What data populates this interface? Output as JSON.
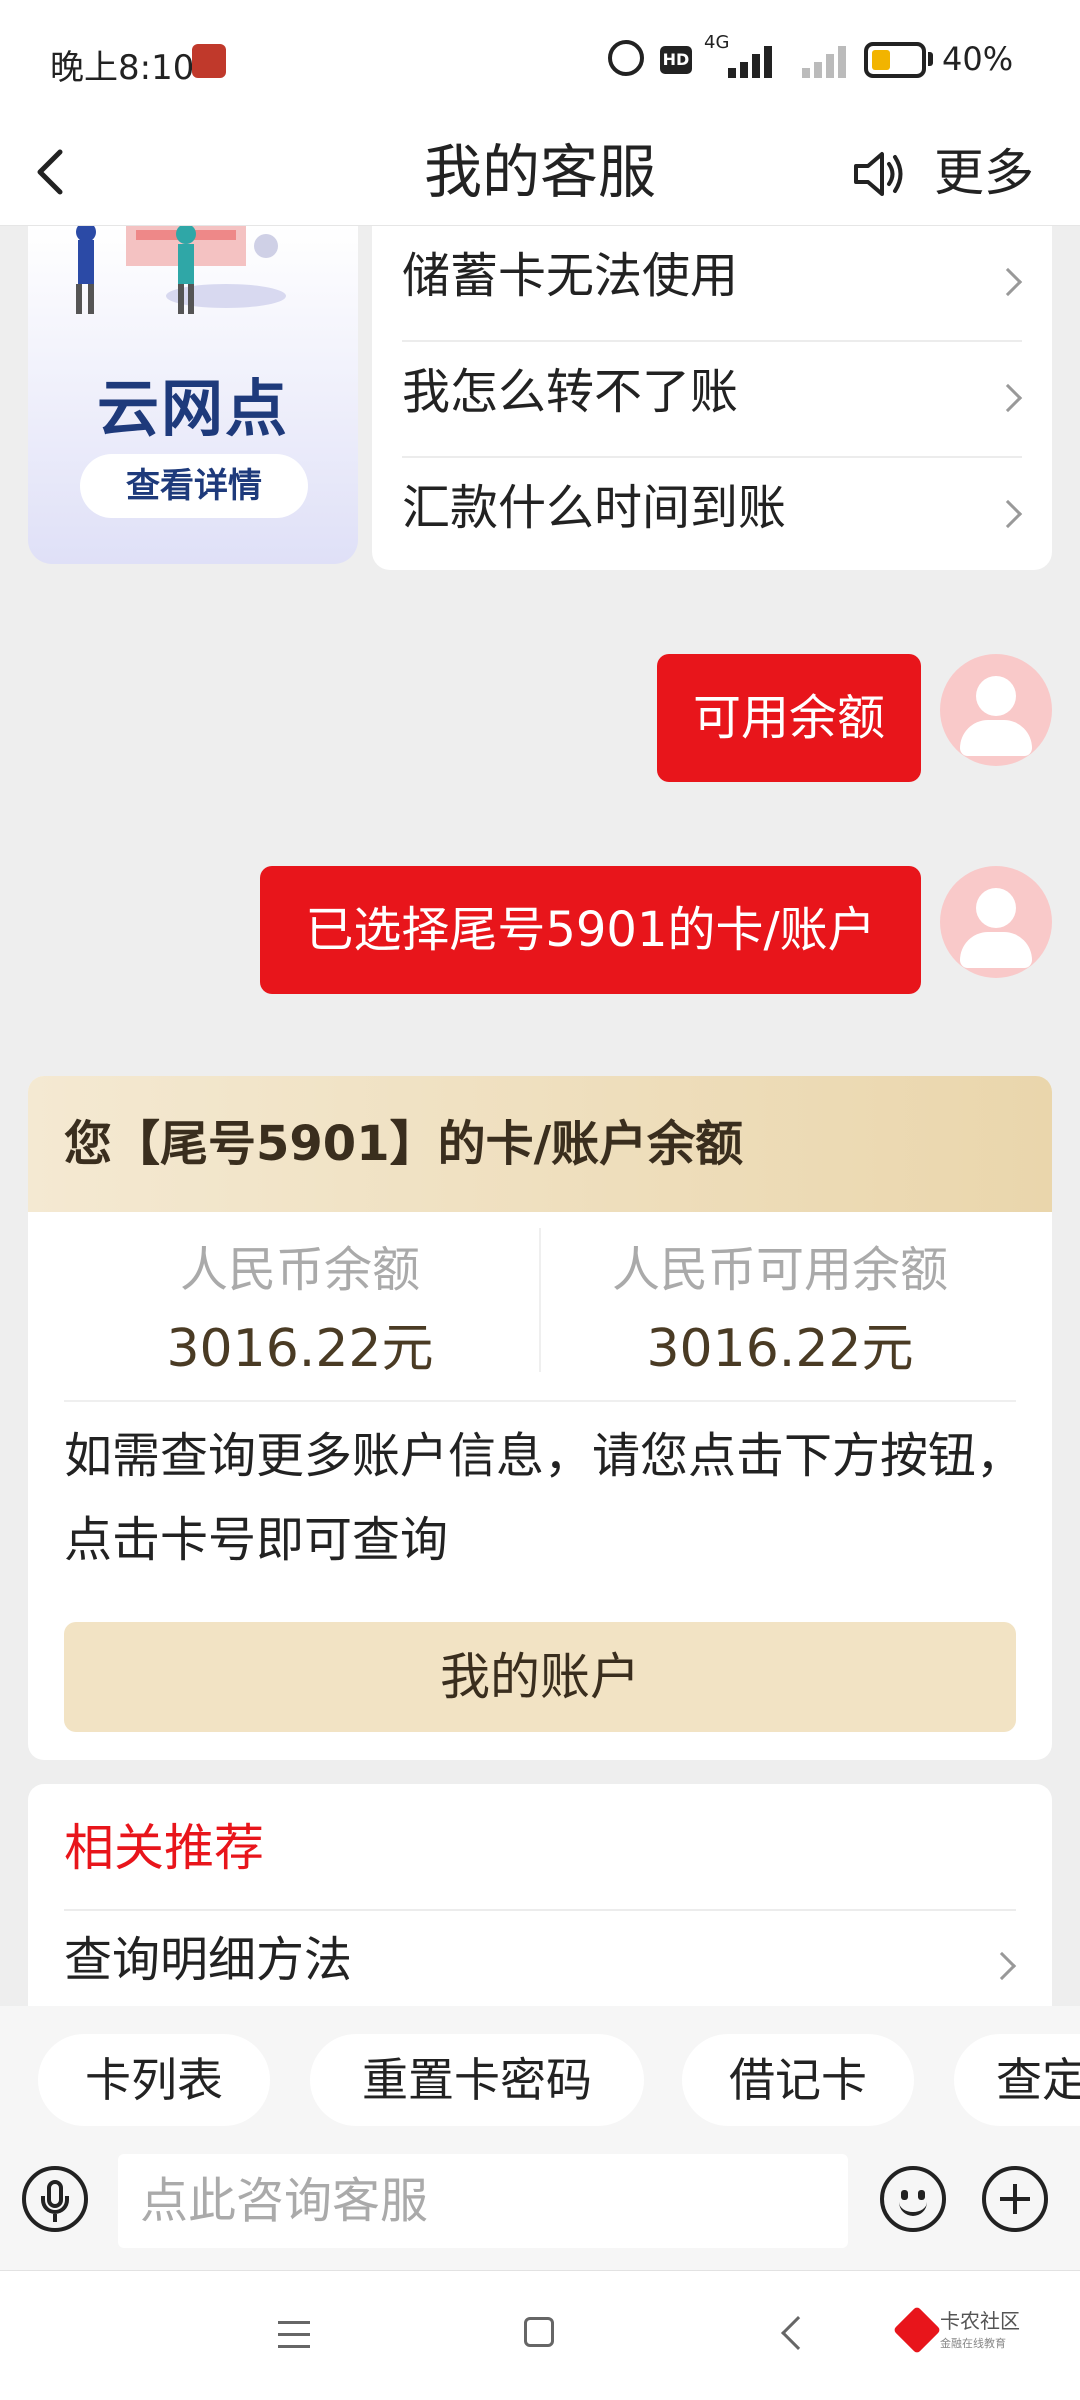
{
  "status_bar": {
    "time": "晚上8:10",
    "network": "4G",
    "hd": "HD",
    "battery": "40%",
    "battery_level": 0.4
  },
  "header": {
    "title": "我的客服",
    "more": "更多",
    "icons": [
      "back-icon",
      "speaker-icon"
    ]
  },
  "promo": {
    "title": "云网点",
    "button": "查看详情"
  },
  "faq": {
    "items": [
      {
        "label": "储蓄卡无法使用"
      },
      {
        "label": "我怎么转不了账"
      },
      {
        "label": "汇款什么时间到账"
      }
    ]
  },
  "messages": [
    {
      "text": "可用余额"
    },
    {
      "text": "已选择尾号5901的卡/账户"
    }
  ],
  "balance": {
    "header": "您【尾号5901】的卡/账户余额",
    "rmb_balance_label": "人民币余额",
    "rmb_balance_value": "3016.22元",
    "rmb_available_label": "人民币可用余额",
    "rmb_available_value": "3016.22元",
    "note": "如需查询更多账户信息，请您点击下方按钮，点击卡号即可查询",
    "button": "我的账户"
  },
  "recommend": {
    "title": "相关推荐",
    "items": [
      {
        "label": "查询明细方法"
      }
    ]
  },
  "quick_chips": [
    "卡列表",
    "重置卡密码",
    "借记卡",
    "查定"
  ],
  "input": {
    "placeholder": "点此咨询客服"
  },
  "watermark": {
    "name": "卡农社区",
    "sub": "金融在线教育"
  },
  "colors": {
    "accent_red": "#e8151b",
    "balance_header_gold": "#ead6ac",
    "button_beige": "#f2e3c4",
    "promo_navy": "#1e3a7b"
  }
}
